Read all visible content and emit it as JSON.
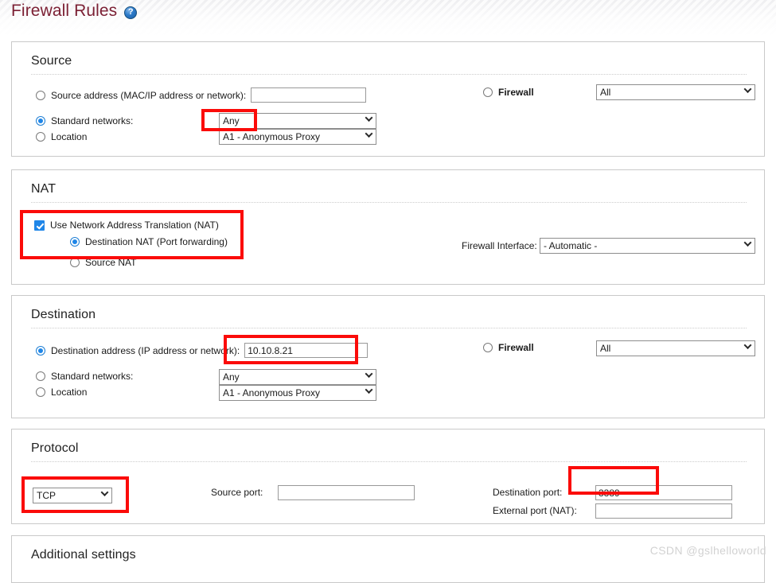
{
  "header": {
    "title": "Firewall Rules",
    "help_icon": "help-circle-icon",
    "help_glyph": "?"
  },
  "source": {
    "section_title": "Source",
    "address_radio_label": "Source address (MAC/IP address or network):",
    "address_value": "",
    "address_placeholder": "",
    "standard_networks_label": "Standard networks:",
    "standard_networks_value": "Any",
    "location_label": "Location",
    "location_value": "A1 - Anonymous Proxy",
    "firewall_label": "Firewall",
    "firewall_value": "All"
  },
  "nat": {
    "section_title": "NAT",
    "use_nat_label": "Use Network Address Translation (NAT)",
    "destination_nat_label": "Destination NAT (Port forwarding)",
    "source_nat_label": "Source NAT",
    "firewall_interface_label": "Firewall Interface:",
    "firewall_interface_value": "- Automatic -"
  },
  "destination": {
    "section_title": "Destination",
    "address_radio_label": "Destination address (IP address or network):",
    "address_value": "10.10.8.21",
    "standard_networks_label": "Standard networks:",
    "standard_networks_value": "Any",
    "location_label": "Location",
    "location_value": "A1 - Anonymous Proxy",
    "firewall_label": "Firewall",
    "firewall_value": "All"
  },
  "protocol": {
    "section_title": "Protocol",
    "protocol_value": "TCP",
    "source_port_label": "Source port:",
    "source_port_value": "",
    "destination_port_label": "Destination port:",
    "destination_port_value": "3389",
    "external_port_label": "External port (NAT):",
    "external_port_value": ""
  },
  "additional": {
    "section_title": "Additional settings"
  },
  "watermark": {
    "text": "CSDN @gslhelloworld"
  },
  "colors": {
    "title": "#7b1f33",
    "annotation": "#fb0b09",
    "accent": "#1f86e8"
  }
}
